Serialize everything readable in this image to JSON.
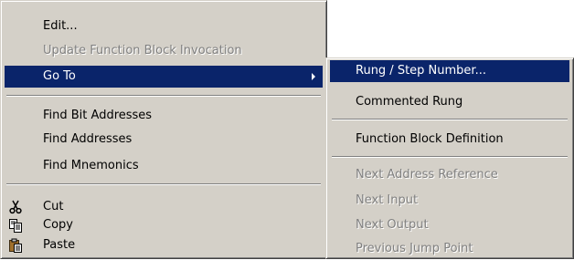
{
  "context_menu": {
    "items": [
      {
        "label": "Edit...",
        "enabled": true
      },
      {
        "label": "Update Function Block Invocation",
        "enabled": false
      },
      {
        "label": "Go To",
        "enabled": true,
        "highlighted": true,
        "has_submenu": true
      },
      {
        "label": "Find Bit Addresses",
        "enabled": true
      },
      {
        "label": "Find Addresses",
        "enabled": true
      },
      {
        "label": "Find Mnemonics",
        "enabled": true
      },
      {
        "label": "Cut",
        "enabled": true,
        "icon": "scissors-icon"
      },
      {
        "label": "Copy",
        "enabled": true,
        "icon": "copy-icon"
      },
      {
        "label": "Paste",
        "enabled": true,
        "icon": "paste-icon"
      }
    ]
  },
  "submenu": {
    "items": [
      {
        "label": "Rung / Step Number...",
        "enabled": true,
        "highlighted": true
      },
      {
        "label": "Commented Rung",
        "enabled": true
      },
      {
        "label": "Function Block Definition",
        "enabled": true
      },
      {
        "label": "Next Address Reference",
        "enabled": false
      },
      {
        "label": "Next Input",
        "enabled": false
      },
      {
        "label": "Next Output",
        "enabled": false
      },
      {
        "label": "Previous Jump Point",
        "enabled": false
      }
    ]
  },
  "colors": {
    "menu_background": "#d4d0c8",
    "highlight_background": "#0a246a",
    "highlight_text": "#ffffff",
    "disabled_text": "#808080"
  }
}
